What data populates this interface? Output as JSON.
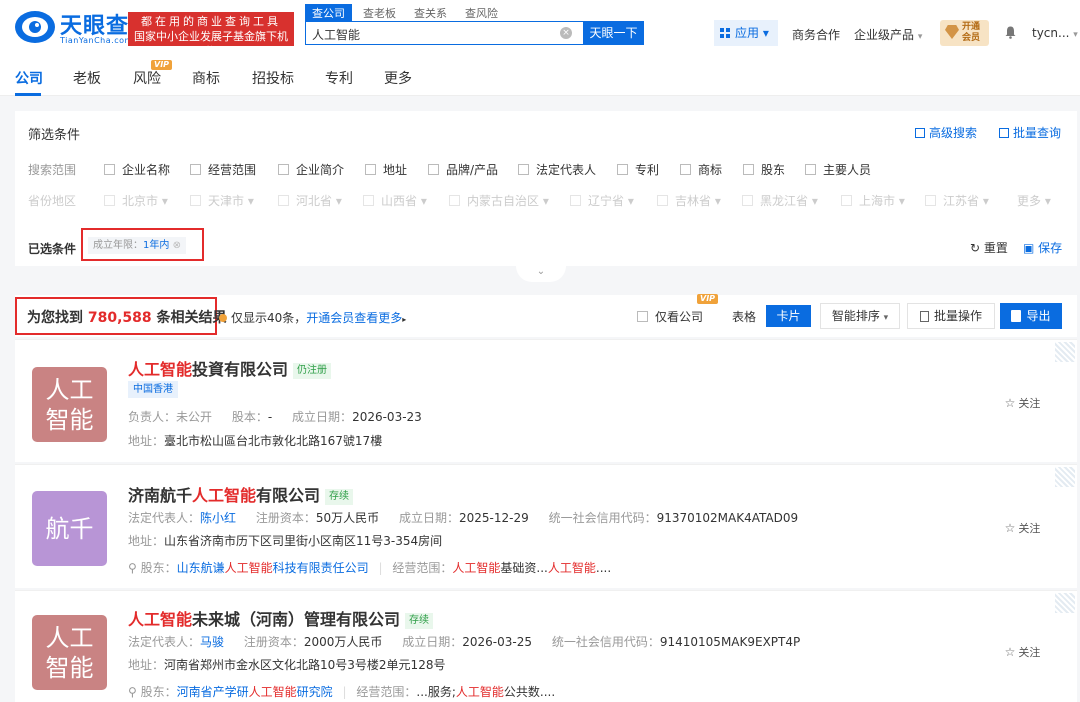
{
  "header": {
    "brand_name": "天眼查",
    "brand_pinyin": "TianYanCha.com",
    "slogan_line1": "都在用的商业查询工具",
    "slogan_line2": "国家中小企业发展子基金旗下机构",
    "search_tabs": [
      "查公司",
      "查老板",
      "查关系",
      "查风险"
    ],
    "search_value": "人工智能",
    "search_button": "天眼一下",
    "app_button": "应用",
    "link_business": "商务合作",
    "link_enterprise": "企业级产品",
    "vip_badge_line1": "开通",
    "vip_badge_line2": "会员",
    "user_name": "tycn..."
  },
  "nav": {
    "tabs": [
      "公司",
      "老板",
      "风险",
      "商标",
      "招投标",
      "专利",
      "更多"
    ],
    "vip_tag": "VIP"
  },
  "filter": {
    "title": "筛选条件",
    "advanced_search": "高级搜索",
    "batch_query": "批量查询",
    "scope_label": "搜索范围",
    "scope_options": [
      "企业名称",
      "经营范围",
      "企业简介",
      "地址",
      "品牌/产品",
      "法定代表人",
      "专利",
      "商标",
      "股东",
      "主要人员"
    ],
    "region_label": "省份地区",
    "provinces": [
      "北京市",
      "天津市",
      "河北省",
      "山西省",
      "内蒙古自治区",
      "辽宁省",
      "吉林省",
      "黑龙江省",
      "上海市",
      "江苏省",
      "更多"
    ],
    "selected_label": "已选条件",
    "selected_chip_key": "成立年限：",
    "selected_chip_value": "1年内",
    "reset": "重置",
    "save": "保存"
  },
  "results": {
    "prefix": "为您找到",
    "count": "780,588",
    "suffix": "条相关结果",
    "limit_text": "仅显示40条，",
    "limit_link": "开通会员查看更多",
    "only_company": "仅看公司",
    "vip_tag": "VIP",
    "view_table": "表格",
    "view_card": "卡片",
    "sort": "智能排序",
    "batch": "批量操作",
    "export": "导出"
  },
  "cards": [
    {
      "logo_text": "人工智能",
      "logo_color": "#c98383",
      "name_hl": "人工智能",
      "name_rest": "投資有限公司",
      "status": "仍注册",
      "region": "中国香港",
      "line1": {
        "k1": "负责人：",
        "v1": "未公开",
        "k2": "股本：",
        "v2": "-",
        "k3": "成立日期：",
        "v3": "2026-03-23"
      },
      "address_label": "地址：",
      "address": "臺北市松山區台北市敦化北路167號17樓",
      "follow": "关注"
    },
    {
      "logo_text": "航千",
      "logo_color": "#b895d6",
      "name_pre": "济南航千",
      "name_hl": "人工智能",
      "name_rest": "有限公司",
      "status": "存续",
      "line1": {
        "k1": "法定代表人：",
        "v1": "陈小红",
        "k2": "注册资本：",
        "v2": "50万人民币",
        "k3": "成立日期：",
        "v3": "2025-12-29",
        "k4": "统一社会信用代码：",
        "v4": "91370102MAK4ATAD09"
      },
      "address_label": "地址：",
      "address": "山东省济南市历下区司里街小区南区11号3-354房间",
      "shareholder_label": "股东：",
      "shareholder_pre": "山东航谦",
      "shareholder_hl": "人工智能",
      "shareholder_rest": "科技有限责任公司",
      "scope_label": "经营范围：",
      "scope_hl1": "人工智能",
      "scope_mid": "基础资...",
      "scope_hl2": "人工智能",
      "scope_end": "....",
      "follow": "关注"
    },
    {
      "logo_text": "人工智能",
      "logo_color": "#c98383",
      "name_hl": "人工智能",
      "name_rest": "未来城（河南）管理有限公司",
      "status": "存续",
      "line1": {
        "k1": "法定代表人：",
        "v1": "马骏",
        "k2": "注册资本：",
        "v2": "2000万人民币",
        "k3": "成立日期：",
        "v3": "2026-03-25",
        "k4": "统一社会信用代码：",
        "v4": "91410105MAK9EXPT4P"
      },
      "address_label": "地址：",
      "address": "河南省郑州市金水区文化北路10号3号楼2单元128号",
      "shareholder_label": "股东：",
      "shareholder_pre": "河南省产学研",
      "shareholder_hl": "人工智能",
      "shareholder_rest": "研究院",
      "scope_label": "经营范围：",
      "scope_pre": "...服务;",
      "scope_hl1": "人工智能",
      "scope_mid": "公共数....",
      "follow": "关注"
    }
  ]
}
